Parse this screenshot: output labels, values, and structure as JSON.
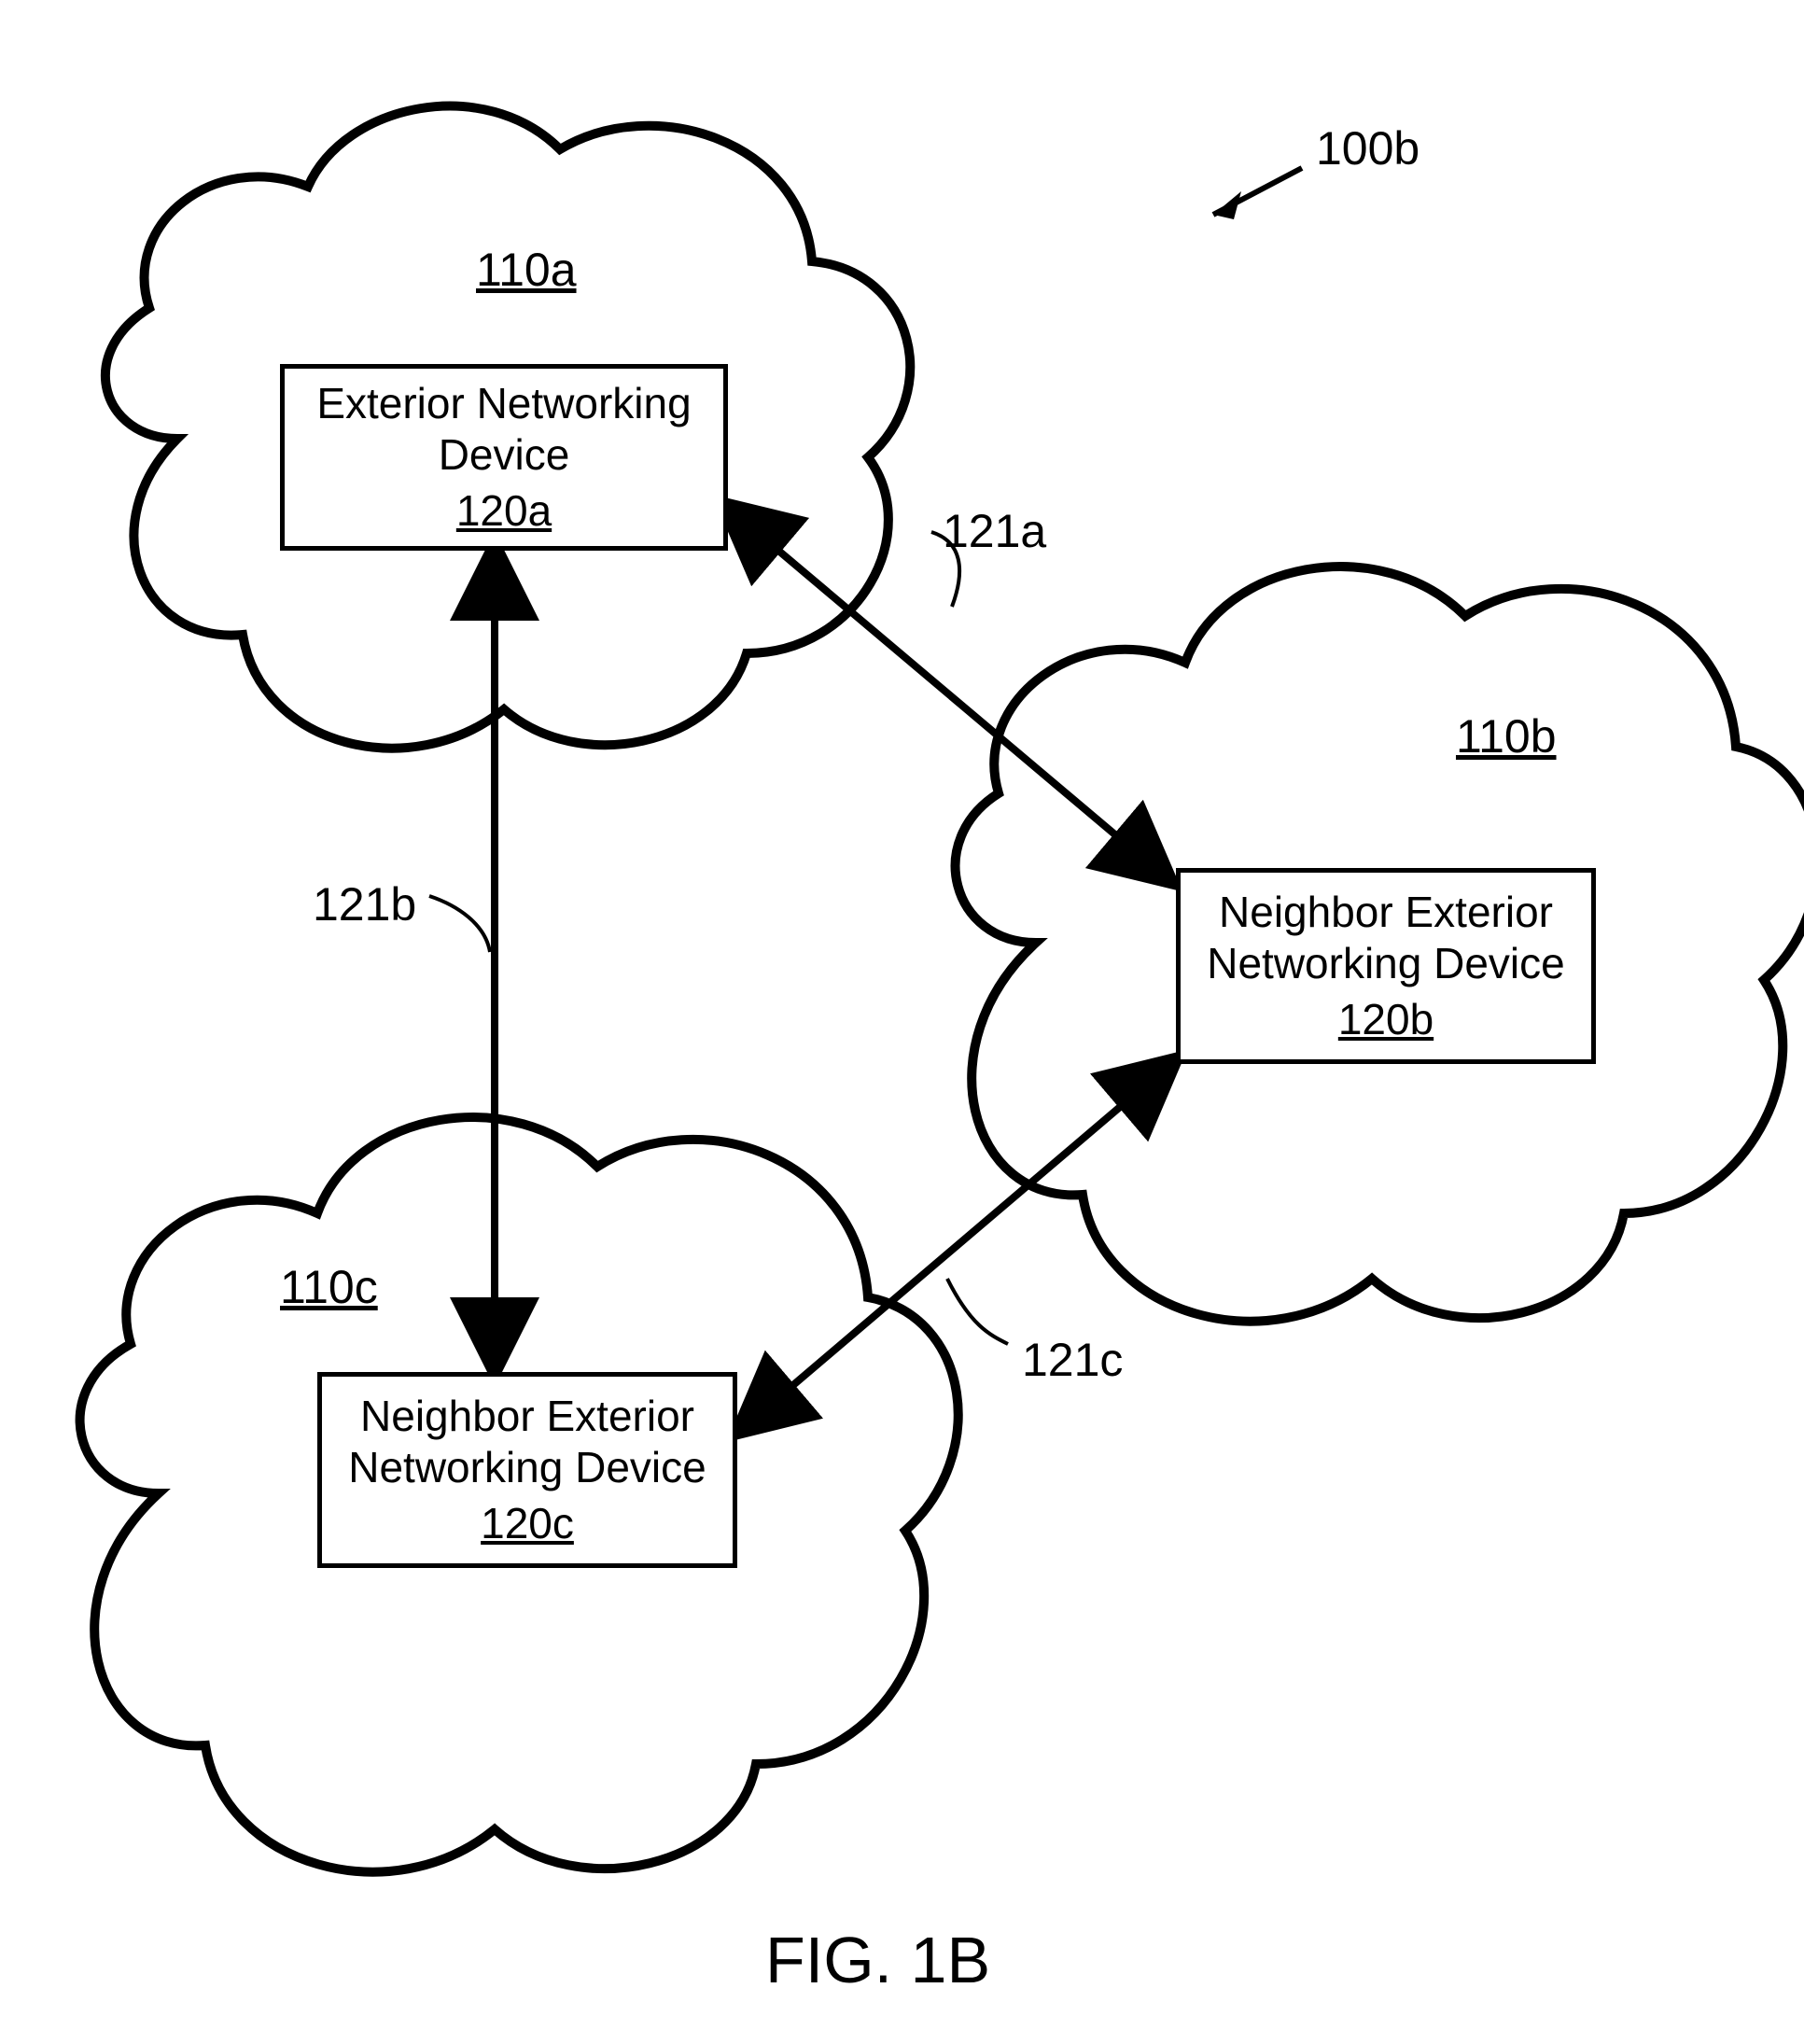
{
  "figure": {
    "title": "FIG. 1B",
    "main_ref": "100b"
  },
  "clouds": {
    "a": {
      "ref": "110a"
    },
    "b": {
      "ref": "110b"
    },
    "c": {
      "ref": "110c"
    }
  },
  "boxes": {
    "a": {
      "line1": "Exterior Networking",
      "line2": "Device",
      "ref": "120a"
    },
    "b": {
      "line1": "Neighbor Exterior",
      "line2": "Networking Device",
      "ref": "120b"
    },
    "c": {
      "line1": "Neighbor Exterior",
      "line2": "Networking Device",
      "ref": "120c"
    }
  },
  "links": {
    "ab": {
      "ref": "121a"
    },
    "ac": {
      "ref": "121b"
    },
    "bc": {
      "ref": "121c"
    }
  }
}
